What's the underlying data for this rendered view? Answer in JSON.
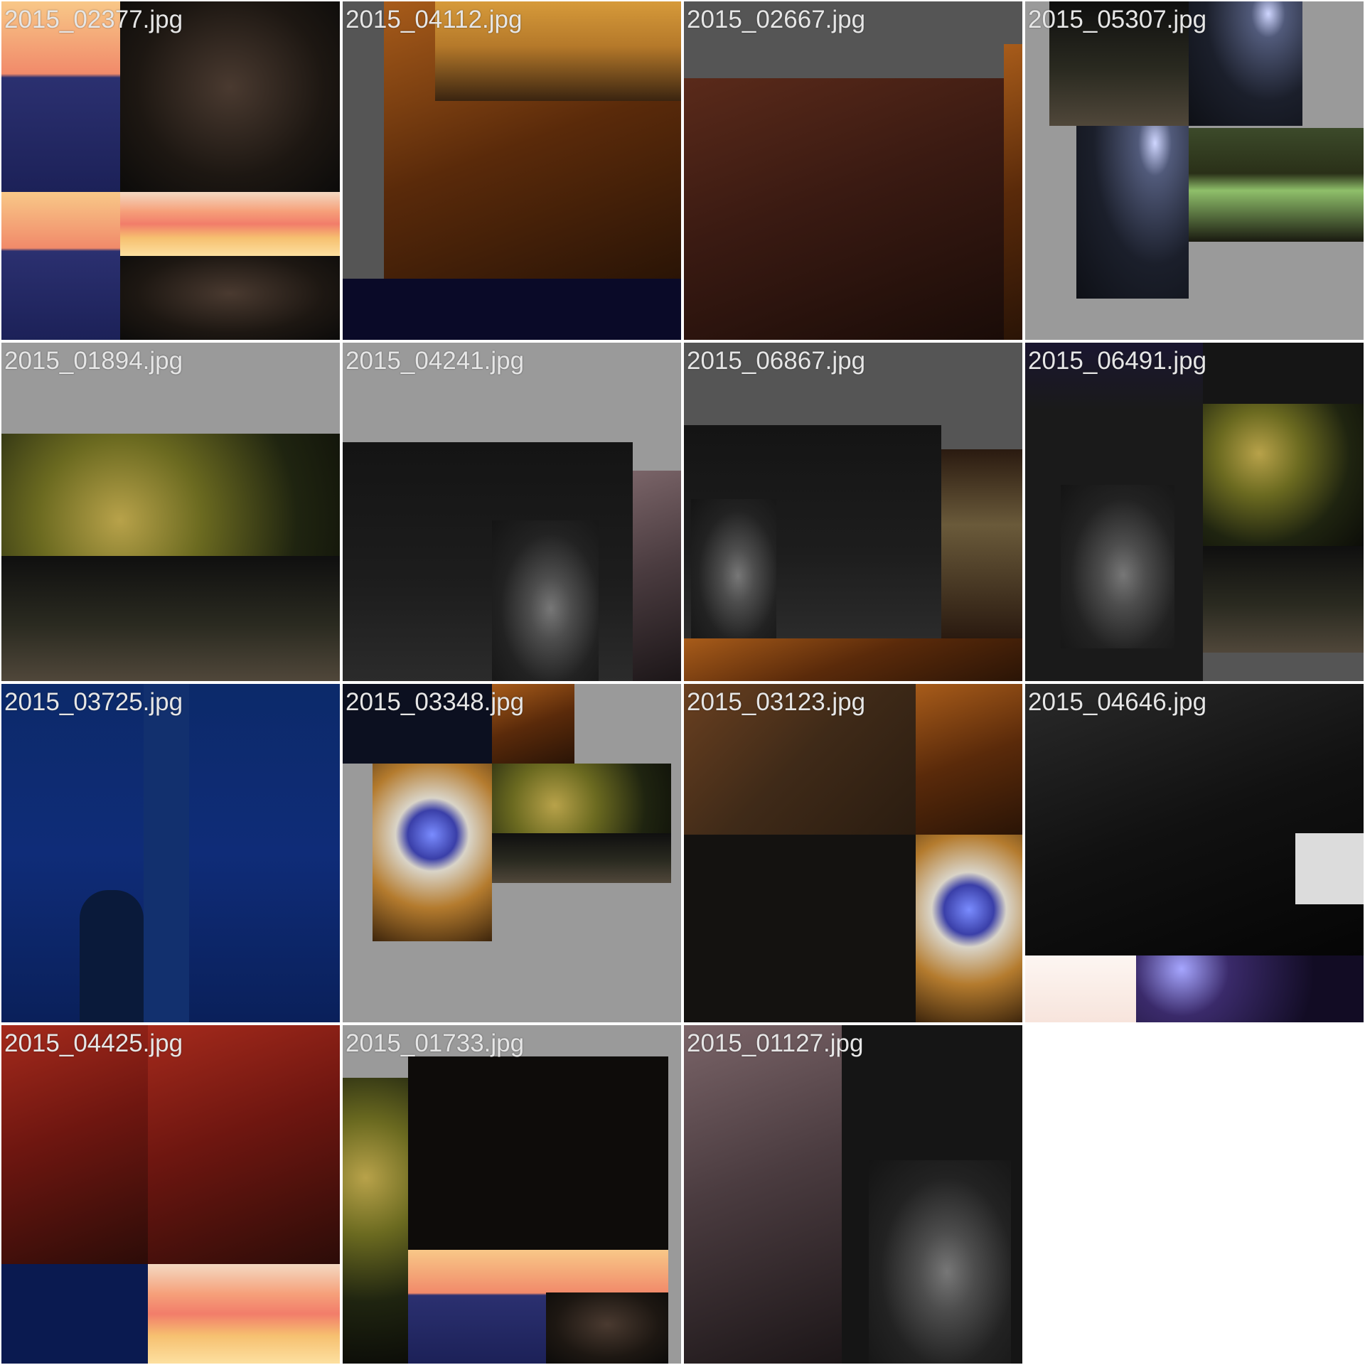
{
  "gallery": {
    "items": [
      {
        "filename": "2015_02377.jpg"
      },
      {
        "filename": "2015_04112.jpg"
      },
      {
        "filename": "2015_02667.jpg"
      },
      {
        "filename": "2015_05307.jpg"
      },
      {
        "filename": "2015_01894.jpg"
      },
      {
        "filename": "2015_04241.jpg"
      },
      {
        "filename": "2015_06867.jpg"
      },
      {
        "filename": "2015_06491.jpg"
      },
      {
        "filename": "2015_03725.jpg"
      },
      {
        "filename": "2015_03348.jpg"
      },
      {
        "filename": "2015_03123.jpg"
      },
      {
        "filename": "2015_04646.jpg"
      },
      {
        "filename": "2015_04425.jpg"
      },
      {
        "filename": "2015_01733.jpg"
      },
      {
        "filename": "2015_01127.jpg"
      }
    ]
  }
}
